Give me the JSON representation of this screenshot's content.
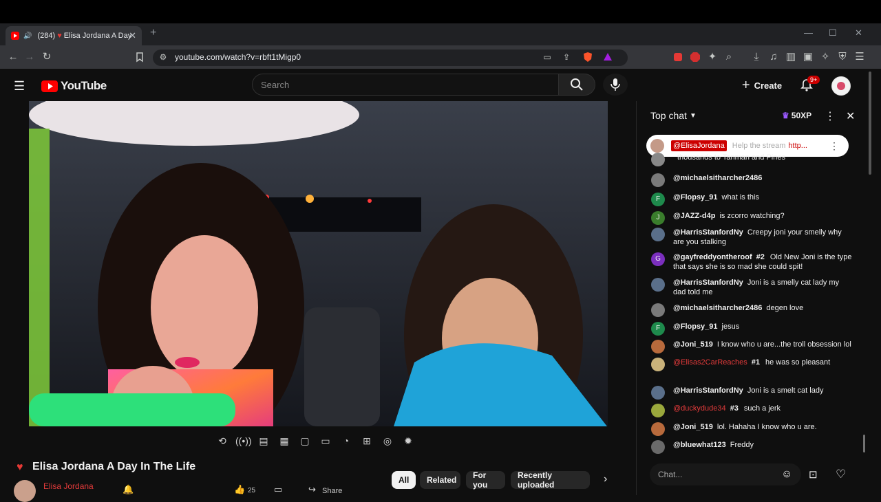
{
  "tab": {
    "count": "(284)",
    "title": "Elisa Jordana A Day In the Life"
  },
  "address": {
    "url": "youtube.com/watch?v=rbft1tMigp0"
  },
  "header": {
    "logo_text": "YouTube",
    "search_placeholder": "Search",
    "create_label": "Create",
    "notif_badge": "9+"
  },
  "video": {
    "title": "Elisa Jordana A Day In The Life",
    "channel": "Elisa Jordana",
    "likes": "25",
    "share_label": "Share"
  },
  "chips": [
    "All",
    "Related",
    "For you",
    "Recently uploaded"
  ],
  "chat": {
    "mode_label": "Top chat",
    "xp_label": "50XP",
    "pinned": {
      "author": "@ElisaJordana",
      "text": "Help the stream",
      "link": "http..."
    },
    "messages": [
      {
        "author": "",
        "text": "thousands to Tanman and Pines",
        "color": "#888888"
      },
      {
        "author": "@michaelsitharcher2486",
        "text": "",
        "color": "#7a7a7a"
      },
      {
        "author": "@Flopsy_91",
        "text": "what is this",
        "color": "#1e8a4c",
        "initial": "F"
      },
      {
        "author": "@JAZZ-d4p",
        "text": "is zcorro watching?",
        "color": "#3a7d2c",
        "initial": "J"
      },
      {
        "author": "@HarrisStanfordNy",
        "text": "Creepy joni your smelly why are you stalking",
        "color": "#5a6f8a"
      },
      {
        "author": "@gayfreddyontheroof",
        "rank": "#2",
        "text": "Old New Joni is the type that says she is so mad she could spit!",
        "color": "#7b2fbe",
        "initial": "G"
      },
      {
        "author": "@HarrisStanfordNy",
        "text": "Joni is a smelly cat lady my dad told me",
        "color": "#5a6f8a"
      },
      {
        "author": "@michaelsitharcher2486",
        "text": "degen love",
        "color": "#7a7a7a"
      },
      {
        "author": "@Flopsy_91",
        "text": "jesus",
        "color": "#1e8a4c",
        "initial": "F"
      },
      {
        "author": "@Joni_519",
        "text": "I know who u are...the troll obsession lol",
        "color": "#b86a3c"
      },
      {
        "author": "@Elisas2CarReaches",
        "rank": "#1",
        "text": "he was so pleasant",
        "color": "#c9b27a",
        "mod": true
      },
      {
        "author": "@HarrisStanfordNy",
        "text": "Joni is a smelt cat lady",
        "color": "#5a6f8a"
      },
      {
        "author": "@duckydude34",
        "rank": "#3",
        "text": "such a jerk",
        "color": "#9aa83c",
        "mod": true
      },
      {
        "author": "@Joni_519",
        "text": "lol. Hahaha I know who u are.",
        "color": "#b86a3c"
      },
      {
        "author": "@bluewhat123",
        "text": "Freddy",
        "color": "#6a6a6a"
      }
    ],
    "input_placeholder": "Chat..."
  }
}
